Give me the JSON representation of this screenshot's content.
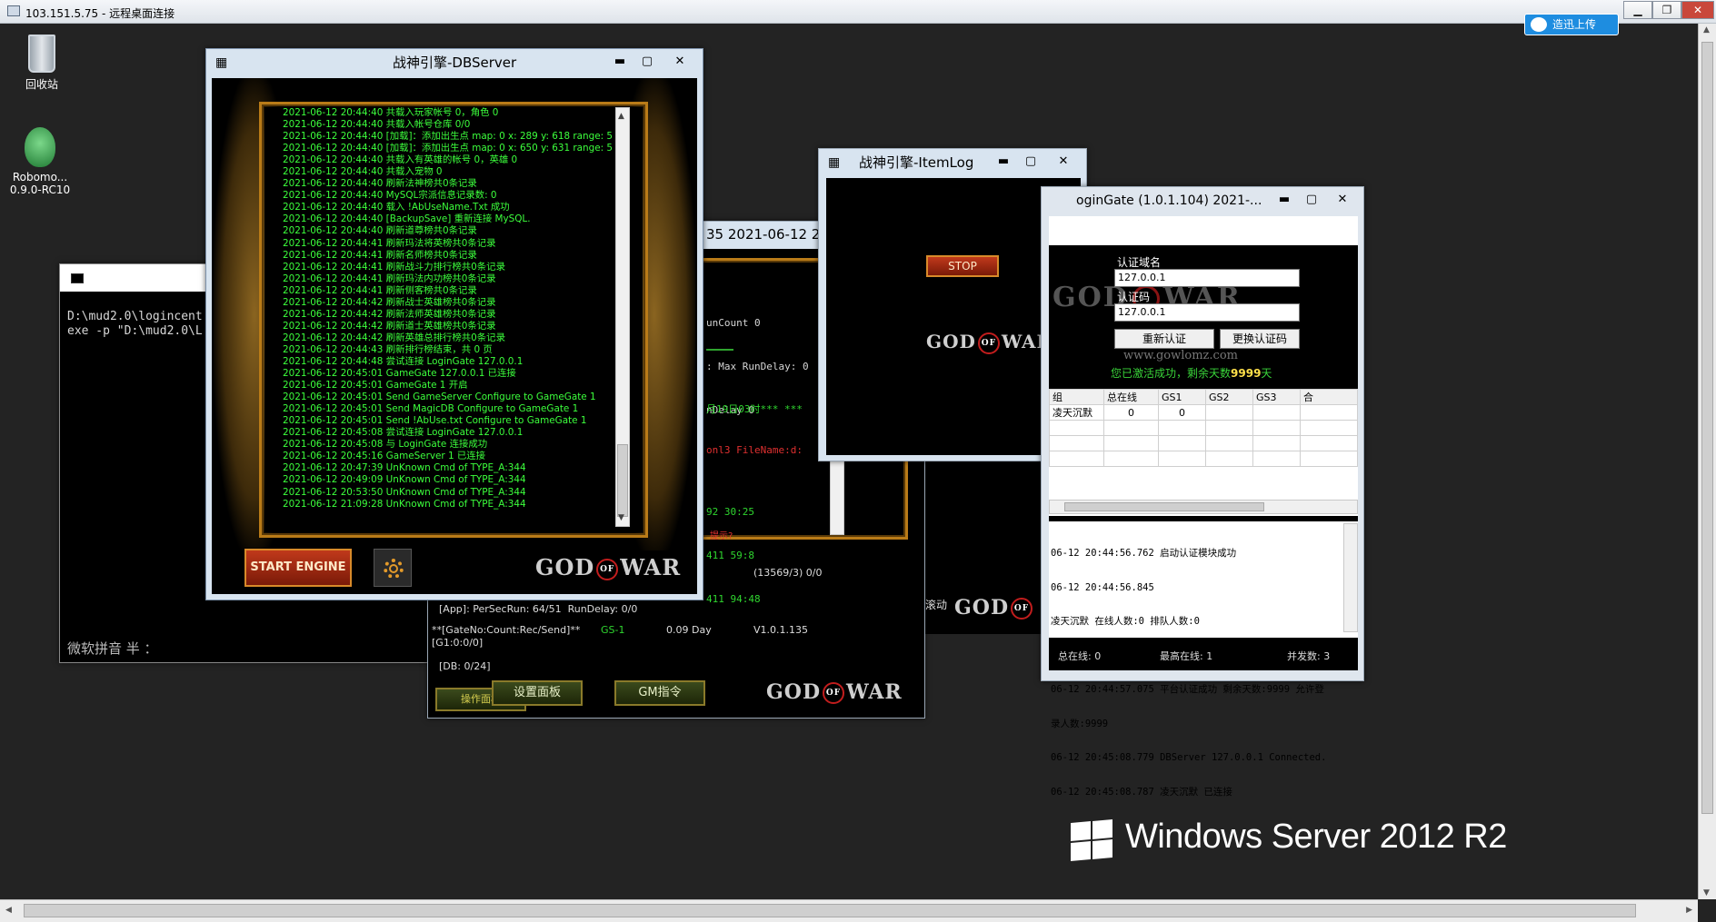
{
  "rdp": {
    "title": "103.151.5.75 - 远程桌面连接",
    "badge": "造迅上传"
  },
  "desktop": {
    "recycle_label": "回收站",
    "robomongo_label": "Robomo...\n0.9.0-RC10"
  },
  "console": {
    "lines": "D:\\mud2.0\\logincent\nexe -p \"D:\\mud2.0\\L",
    "ime": "微软拼音 半 ："
  },
  "dbserver": {
    "title": "战神引擎-DBServer",
    "log": [
      "2021-06-12 20:44:40 共载入玩家帐号 0，角色 0",
      "2021-06-12 20:44:40 共载入帐号仓库 0/0",
      "2021-06-12 20:44:40 [加载]：添加出生点 map: 0 x: 289 y: 618 range: 5",
      "2021-06-12 20:44:40 [加载]：添加出生点 map: 0 x: 650 y: 631 range: 5",
      "2021-06-12 20:44:40 共载入有英雄的帐号 0，英雄 0",
      "2021-06-12 20:44:40 共载入宠物 0",
      "2021-06-12 20:44:40 刷新法神榜共0条记录",
      "2021-06-12 20:44:40 MySQL宗派信息记录数: 0",
      "2021-06-12 20:44:40 载入 !AbUseName.Txt 成功",
      "2021-06-12 20:44:40 [BackupSave] 重新连接 MySQL.",
      "2021-06-12 20:44:40 刷新道尊榜共0条记录",
      "2021-06-12 20:44:41 刷新玛法将英榜共0条记录",
      "2021-06-12 20:44:41 刷新名师榜共0条记录",
      "2021-06-12 20:44:41 刷新战斗力排行榜共0条记录",
      "2021-06-12 20:44:41 刷新玛法内功榜共0条记录",
      "2021-06-12 20:44:41 刷新侧客榜共0条记录",
      "2021-06-12 20:44:42 刷新战士英雄榜共0条记录",
      "2021-06-12 20:44:42 刷新法师英雄榜共0条记录",
      "2021-06-12 20:44:42 刷新道士英雄榜共0条记录",
      "2021-06-12 20:44:42 刷新英雄总排行榜共0条记录",
      "2021-06-12 20:44:43 刷新排行榜结束，共 0 页",
      "2021-06-12 20:44:48 尝试连接 LoginGate 127.0.0.1",
      "2021-06-12 20:45:01 GameGate 127.0.0.1 已连接",
      "2021-06-12 20:45:01 GameGate 1 开启",
      "2021-06-12 20:45:01 Send GameServer Configure to GameGate 1",
      "2021-06-12 20:45:01 Send MagicDB Configure to GameGate 1",
      "2021-06-12 20:45:01 Send !AbUse.txt Configure to GameGate 1",
      "2021-06-12 20:45:08 尝试连接 LoginGate 127.0.0.1",
      "2021-06-12 20:45:08 与 LoginGate 连接成功",
      "2021-06-12 20:45:16 GameServer 1 已连接",
      "2021-06-12 20:47:39 UnKnown Cmd of TYPE_A:344",
      "2021-06-12 20:49:09 UnKnown Cmd of TYPE_A:344",
      "2021-06-12 20:53:50 UnKnown Cmd of TYPE_A:344",
      "2021-06-12 21:09:28 UnKnown Cmd of TYPE_A:344"
    ],
    "start_button": "START ENGINE",
    "logo": {
      "god": "GOD",
      "of": "OF",
      "war": "WAR"
    }
  },
  "gameserver": {
    "title": "35 2021-06-12 2...",
    "lines_top": [
      "unCount 0",
      ": Max RunDelay: 0",
      "nDelay 0"
    ],
    "date_line": "月19日03时*** ***",
    "file_line": "onl3 FileName:d:",
    "stats": [
      "92 30:25",
      "411 59:8",
      "411 94:48"
    ],
    "red_label": "提示?",
    "count": "(13569/3) 0/0",
    "app_line": "[App]: PerSecRun: 64/51  RunDelay: 0/0",
    "gate_label": "**[GateNo:Count:Rec/Send]**",
    "gs_label": "GS-1",
    "day": "0.09 Day",
    "version": "V1.0.1.135",
    "g1": "[G1:0:0/0]",
    "db": "[DB: 0/24]",
    "btn_ops": "操作面板",
    "btn_settings": "设置面板",
    "btn_gm": "GM指令"
  },
  "itemlog": {
    "title": "战神引擎-ItemLog",
    "stop": "STOP",
    "scroll_label": "滚动"
  },
  "logingate": {
    "title": "oginGate (1.0.1.104)   2021-...",
    "label_domain": "认证域名",
    "domain_value": "127.0.0.1",
    "label_code": "认证码",
    "code_value": "127.0.0.1",
    "btn_reauth": "重新认证",
    "btn_changecode": "更换认证码",
    "website": "www.gowlomz.com",
    "auth_msg_prefix": "您已激活成功，剩余天数",
    "auth_days": "9999",
    "auth_msg_suffix": "天",
    "table_headers": [
      "组",
      "总在线",
      "GS1",
      "GS2",
      "GS3",
      "合"
    ],
    "table_row": [
      "凌天沉默",
      "0",
      "0",
      "",
      "",
      ""
    ],
    "log": [
      "06-12 20:44:56.762 启动认证模块成功",
      "06-12 20:44:56.845",
      "凌天沉默 在线人数:0 排队人数:0",
      "",
      "06-12 20:44:57.075 平台认证成功 剩余天数:9999 允许登",
      "录人数:9999",
      "06-12 20:45:08.779 DBServer 127.0.0.1 Connected.",
      "06-12 20:45:08.787 凌天沉默 已连接"
    ],
    "status_total": "总在线: 0",
    "status_max": "最高在线: 1",
    "status_conc": "并发数: 3"
  },
  "brand": {
    "os": "Windows Server 2012 R2"
  }
}
